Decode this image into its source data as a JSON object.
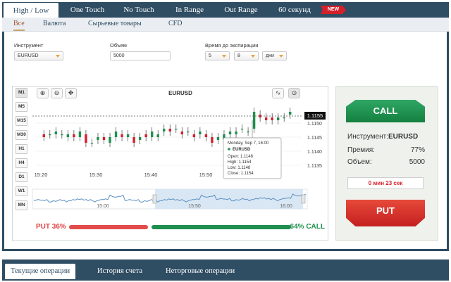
{
  "top_tabs": [
    {
      "label": "High / Low"
    },
    {
      "label": "One Touch"
    },
    {
      "label": "No Touch"
    },
    {
      "label": "In Range"
    },
    {
      "label": "Out Range"
    },
    {
      "label": "60 секунд"
    }
  ],
  "new_badge": "NEW",
  "sub_tabs": [
    {
      "label": "Все"
    },
    {
      "label": "Валюта"
    },
    {
      "label": "Сырьевые товары"
    },
    {
      "label": "CFD"
    }
  ],
  "form": {
    "instrument_label": "Инструмент",
    "instrument_value": "EURUSD",
    "volume_label": "Объем",
    "volume_value": "5000",
    "expiry_label": "Время до экспирации",
    "expiry_value": "5",
    "expiry_value2": "8",
    "expiry_unit": "дни"
  },
  "chart": {
    "title": "EURUSD",
    "timeframes": [
      "M1",
      "M5",
      "M15",
      "M30",
      "H1",
      "H4",
      "D1",
      "W1",
      "MN"
    ],
    "current_price": "1.1155",
    "tooltip": {
      "date": "Monday, Sep 7, 16:00",
      "symbol": "EURUSD",
      "open": "Open: 1.1148",
      "high": "High: 1.1154",
      "low": "Low: 1.1148",
      "close": "Close: 1.1154"
    },
    "put_label": "PUT 36%",
    "call_label": "64% CALL",
    "put_pct": 36,
    "call_pct": 64
  },
  "chart_data": {
    "type": "candlestick",
    "title": "EURUSD",
    "x_ticks": [
      "15:20",
      "15:30",
      "15:40",
      "15:50"
    ],
    "y_ticks": [
      "1.1150",
      "1.1145",
      "1.1140",
      "1.1135"
    ],
    "navigator_ticks": [
      "15:00",
      "15:50",
      "16:00"
    ],
    "candles": [
      {
        "o": 1.1146,
        "c": 1.1145
      },
      {
        "o": 1.1146,
        "c": 1.1146
      },
      {
        "o": 1.1146,
        "c": 1.1147
      },
      {
        "o": 1.1146,
        "c": 1.1146
      },
      {
        "o": 1.1145,
        "c": 1.1146
      },
      {
        "o": 1.1146,
        "c": 1.1145
      },
      {
        "o": 1.1145,
        "c": 1.1147
      },
      {
        "o": 1.1146,
        "c": 1.1143
      },
      {
        "o": 1.1143,
        "c": 1.1143
      },
      {
        "o": 1.1144,
        "c": 1.1145
      },
      {
        "o": 1.1145,
        "c": 1.1144
      },
      {
        "o": 1.1143,
        "c": 1.1145
      },
      {
        "o": 1.1145,
        "c": 1.1147
      },
      {
        "o": 1.1146,
        "c": 1.1145
      },
      {
        "o": 1.1145,
        "c": 1.1146
      },
      {
        "o": 1.1145,
        "c": 1.1143
      },
      {
        "o": 1.1144,
        "c": 1.1145
      },
      {
        "o": 1.1146,
        "c": 1.1145
      },
      {
        "o": 1.1145,
        "c": 1.1147
      },
      {
        "o": 1.1145,
        "c": 1.1146
      },
      {
        "o": 1.1147,
        "c": 1.1148
      },
      {
        "o": 1.1148,
        "c": 1.1147
      },
      {
        "o": 1.1148,
        "c": 1.1148
      },
      {
        "o": 1.1147,
        "c": 1.1146
      },
      {
        "o": 1.1147,
        "c": 1.1147
      },
      {
        "o": 1.1146,
        "c": 1.1145
      },
      {
        "o": 1.1146,
        "c": 1.1147
      },
      {
        "o": 1.1146,
        "c": 1.1145
      },
      {
        "o": 1.1145,
        "c": 1.1143
      },
      {
        "o": 1.1144,
        "c": 1.1145
      },
      {
        "o": 1.1144,
        "c": 1.1146
      },
      {
        "o": 1.1146,
        "c": 1.1147
      },
      {
        "o": 1.1146,
        "c": 1.1147
      },
      {
        "o": 1.1148,
        "c": 1.1148
      },
      {
        "o": 1.1147,
        "c": 1.1147
      },
      {
        "o": 1.1148,
        "c": 1.1154
      },
      {
        "o": 1.1153,
        "c": 1.1152
      },
      {
        "o": 1.1152,
        "c": 1.1151
      },
      {
        "o": 1.1152,
        "c": 1.1151
      },
      {
        "o": 1.1151,
        "c": 1.1152
      },
      {
        "o": 1.1152,
        "c": 1.1152
      },
      {
        "o": 1.1153,
        "c": 1.1154
      }
    ],
    "ylim": [
      1.1133,
      1.1158
    ]
  },
  "trade": {
    "call_label": "CALL",
    "put_label": "PUT",
    "instrument_label": "Инструмент:",
    "instrument_value": "EURUSD",
    "premium_label": "Премия:",
    "premium_value": "77%",
    "volume_label": "Объем:",
    "volume_value": "5000",
    "timer": "0 мин 23 сек"
  },
  "bottom_tabs": [
    {
      "label": "Текущие операции"
    },
    {
      "label": "История счета"
    },
    {
      "label": "Неторговые операции"
    }
  ],
  "colors": {
    "navy": "#2f4d63",
    "bull": "#1e8f4e",
    "bear": "#d4202b",
    "accent": "#e8a33d"
  }
}
